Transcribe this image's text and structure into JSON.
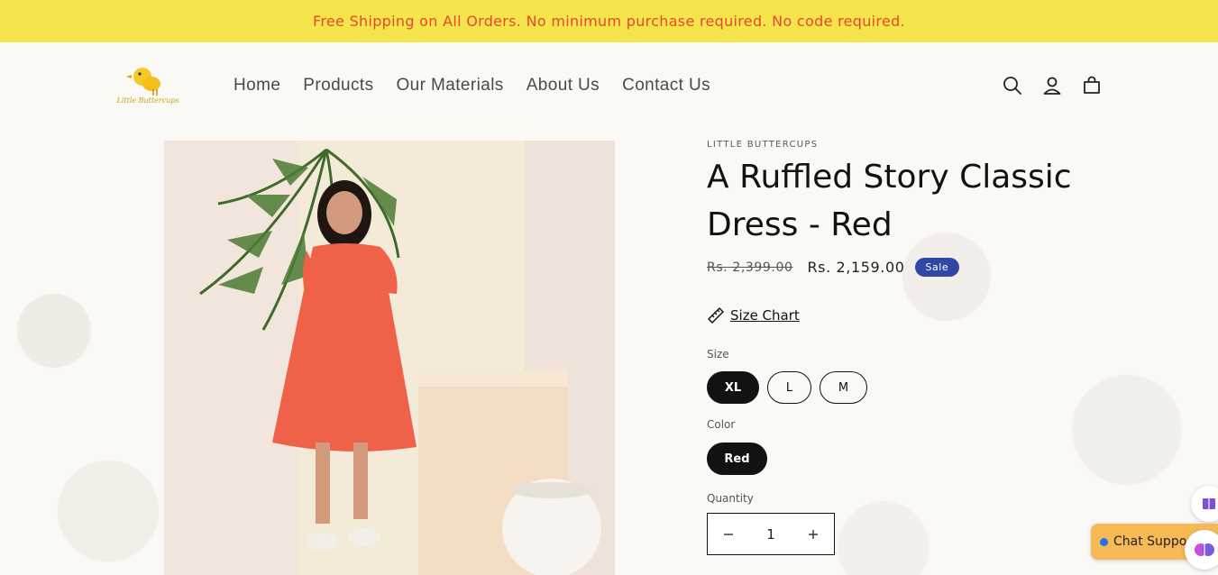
{
  "announcement": {
    "text": "Free Shipping on All Orders. No minimum purchase required. No code required."
  },
  "brand": {
    "logo_text": "Little Buttercups"
  },
  "nav": {
    "items": [
      {
        "label": "Home"
      },
      {
        "label": "Products"
      },
      {
        "label": "Our Materials"
      },
      {
        "label": "About Us"
      },
      {
        "label": "Contact Us"
      }
    ]
  },
  "header_icons": [
    "search-icon",
    "account-icon",
    "cart-icon"
  ],
  "product": {
    "vendor": "LITTLE BUTTERCUPS",
    "title": "A Ruffled Story Classic Dress - Red",
    "regular_price": "Rs. 2,399.00",
    "sale_price": "Rs. 2,159.00",
    "sale_badge": "Sale",
    "size_chart_label": "Size Chart",
    "size_label": "Size",
    "sizes": [
      {
        "label": "XL",
        "selected": true
      },
      {
        "label": "L",
        "selected": false
      },
      {
        "label": "M",
        "selected": false
      }
    ],
    "color_label": "Color",
    "colors": [
      {
        "label": "Red",
        "selected": true
      }
    ],
    "quantity_label": "Quantity",
    "quantity": "1"
  },
  "chat": {
    "label": "Chat Support"
  },
  "colors": {
    "announcement_bg": "#f6e44c",
    "announcement_text": "#e6492d",
    "sale_badge": "#3048a5",
    "chat_bg": "#f6b955"
  }
}
